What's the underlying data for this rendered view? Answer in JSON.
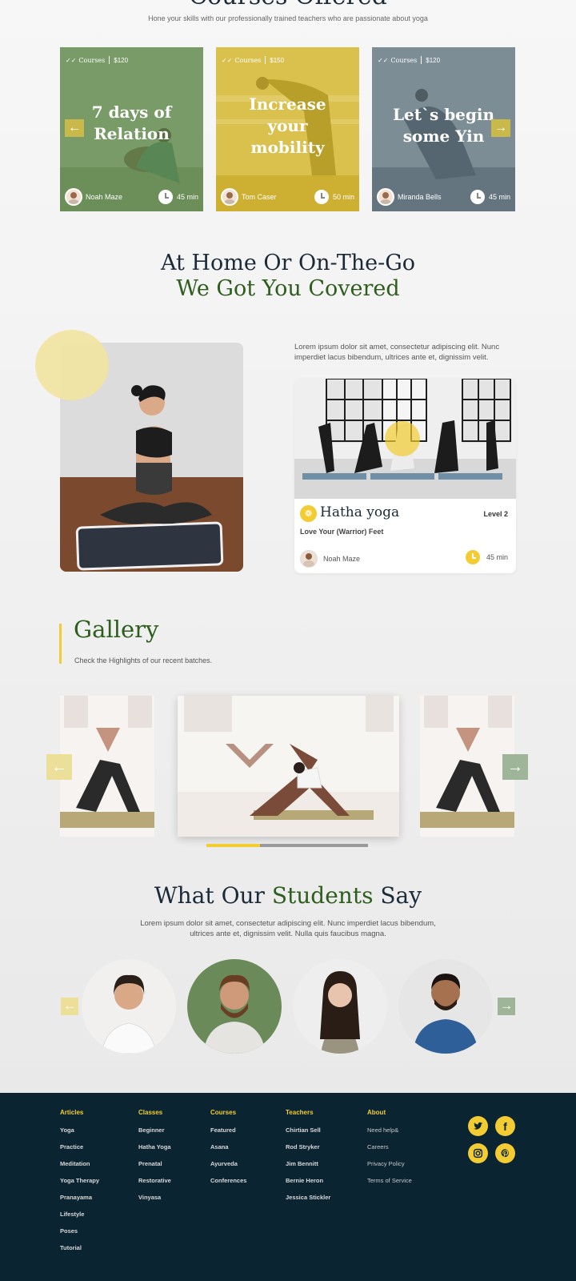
{
  "courses_section": {
    "title": "Courses Offered",
    "subtitle": "Hone your skills with our professionally trained teachers who are passionate about yoga",
    "cards": [
      {
        "tag": "Courses",
        "price": "$120",
        "title_lines": [
          "7 days of",
          "Relation"
        ],
        "author": "Noah Maze",
        "duration": "45 min",
        "color": "#5f8a4e"
      },
      {
        "tag": "Courses",
        "price": "$150",
        "title_lines": [
          "Increase",
          "your",
          "mobility"
        ],
        "author": "Tom Caser",
        "duration": "50 min",
        "color": "#d6b72c"
      },
      {
        "tag": "Courses",
        "price": "$120",
        "title_lines": [
          "Let`s begin",
          "some Yin"
        ],
        "author": "Miranda Bells",
        "duration": "45 min",
        "color": "#5f727c"
      }
    ],
    "accent": "#c9b84a"
  },
  "home_section": {
    "title_line1": "At Home Or On-The-Go",
    "title_line2": "We Got You Covered",
    "description": "Lorem ipsum dolor sit amet, consectetur adipiscing elit. Nunc imperdiet lacus bibendum, ultrices ante et, dignissim velit.",
    "class_card": {
      "name": "Hatha yoga",
      "level": "Level 2",
      "subtitle": "Love Your (Warrior) Feet",
      "author": "Noah Maze",
      "duration": "45 min"
    }
  },
  "gallery": {
    "title": "Gallery",
    "subtitle": "Check the Highlights of  our recent batches.",
    "progress": 0.33
  },
  "students": {
    "title_part1": "What Our",
    "title_part2": "Students",
    "title_part3": "Say",
    "text": "Lorem ipsum dolor sit amet, consectetur adipiscing elit. Nunc imperdiet lacus bibendum, ultrices ante et, dignissim velit. Nulla quis faucibus magna."
  },
  "footer": {
    "columns": [
      {
        "heading": "Articles",
        "items": [
          "Yoga",
          "Practice",
          "Meditation",
          "Yoga Therapy",
          "Pranayama",
          "Lifestyle",
          "Poses",
          "Tutorial"
        ]
      },
      {
        "heading": "Classes",
        "items": [
          "Beginner",
          "Hatha Yoga",
          "Prenatal",
          "Restorative",
          "Vinyasa"
        ]
      },
      {
        "heading": "Courses",
        "items": [
          "Featured",
          "Asana",
          "Ayurveda",
          "Conferences"
        ]
      },
      {
        "heading": "Teachers",
        "items": [
          "Chirtian Sell",
          "Rod Stryker",
          "Jim Bennitt",
          "Bernie Heron",
          "Jessica Stickler"
        ]
      },
      {
        "heading": "About",
        "items": [
          "Need help&",
          "Careers",
          "Privacy Policy",
          "Terms of Service"
        ]
      }
    ],
    "social_icons": [
      "twitter-icon",
      "facebook-icon",
      "instagram-icon",
      "pinterest-icon"
    ]
  },
  "colors": {
    "yellow": "#f2cc32",
    "green": "#2e5e1e",
    "navy": "#1b2a38",
    "footer_bg": "#0b2432"
  }
}
